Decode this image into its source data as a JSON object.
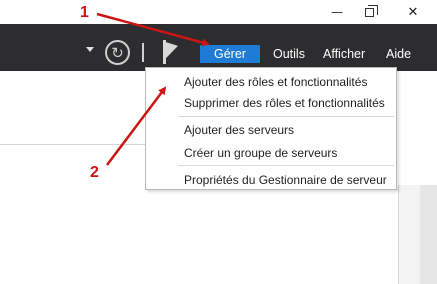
{
  "window": {
    "min_glyph": "—",
    "close_glyph": "✕"
  },
  "toolbar": {
    "refresh_glyph": "↻"
  },
  "menubar": {
    "items": [
      {
        "label": "Gérer",
        "active": true
      },
      {
        "label": "Outils",
        "active": false
      },
      {
        "label": "Afficher",
        "active": false
      },
      {
        "label": "Aide",
        "active": false
      }
    ]
  },
  "dropdown": {
    "items": [
      "Ajouter des rôles et fonctionnalités",
      "Supprimer des rôles et fonctionnalités",
      "Ajouter des serveurs",
      "Créer un groupe de serveurs",
      "Propriétés du Gestionnaire de serveur"
    ]
  },
  "annotations": {
    "step1": "1",
    "step2": "2"
  },
  "colors": {
    "menubar_bg": "#2d2d30",
    "active_menu_bg": "#1e7bd6",
    "annotation_red": "#cc1414"
  },
  "icons": [
    "minimize-icon",
    "maximize-icon",
    "close-icon",
    "dropdown-arrow-icon",
    "refresh-icon",
    "flag-icon"
  ]
}
